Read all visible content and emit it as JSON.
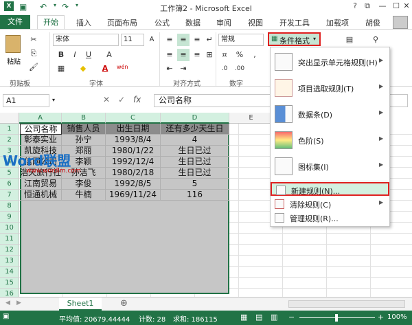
{
  "titlebar": {
    "title": "工作簿2 - Microsoft Excel",
    "help": "?",
    "restore": "⧉",
    "minimize": "—",
    "maximize": "☐",
    "close": "✕"
  },
  "tabs": {
    "file": "文件",
    "home": "开始",
    "insert": "插入",
    "page_layout": "页面布局",
    "formulas": "公式",
    "data": "数据",
    "review": "审阅",
    "view": "视图",
    "developer": "开发工具",
    "addins": "加载项",
    "user": "胡俊"
  },
  "ribbon": {
    "paste": "粘贴",
    "clipboard": "剪贴板",
    "font_name": "宋体",
    "font_size": "11",
    "font_group": "字体",
    "align_group": "对齐方式",
    "number_format": "常规",
    "number_group": "数字",
    "conditional_format": "条件格式",
    "bold": "B",
    "italic": "I",
    "underline": "U",
    "font_color": "A",
    "wen": "wén"
  },
  "formula_bar": {
    "name_box": "A1",
    "fx": "fx",
    "value": "公司名称"
  },
  "grid": {
    "columns": [
      "A",
      "B",
      "C",
      "D",
      "E"
    ],
    "rows": [
      [
        "公司名称",
        "销售人员",
        "出生日期",
        "还有多少天生日"
      ],
      [
        "彰泰实业",
        "孙宁",
        "1993/8/4",
        "4"
      ],
      [
        "凯旋科技",
        "郑丽",
        "1980/1/22",
        "生日已过"
      ],
      [
        "信网公司",
        "李颖",
        "1992/12/4",
        "生日已过"
      ],
      [
        "浩天旅行社",
        "孙洁飞",
        "1980/2/18",
        "生日已过"
      ],
      [
        "江南贸易",
        "李俊",
        "1992/8/5",
        "5"
      ],
      [
        "恒通机械",
        "牛楠",
        "1969/11/24",
        "116"
      ]
    ],
    "row_numbers": [
      "1",
      "2",
      "3",
      "4",
      "5",
      "6",
      "7",
      "8",
      "9",
      "10",
      "11",
      "12",
      "13",
      "14",
      "15",
      "16"
    ]
  },
  "watermark": {
    "brand": "Word联盟",
    "url": "www.wordlm.com"
  },
  "menu": {
    "items": [
      {
        "label": "突出显示单元格规则(H)"
      },
      {
        "label": "项目选取规则(T)"
      },
      {
        "label": "数据条(D)"
      },
      {
        "label": "色阶(S)"
      },
      {
        "label": "图标集(I)"
      }
    ],
    "small_items": [
      {
        "label": "新建规则(N)..."
      },
      {
        "label": "清除规则(C)"
      },
      {
        "label": "管理规则(R)..."
      }
    ]
  },
  "sheets": {
    "tab": "Sheet1",
    "add": "⊕"
  },
  "status": {
    "average": "平均值: 20679.44444",
    "count": "计数: 28",
    "sum": "求和: 186115",
    "zoom": "100%",
    "plus": "+",
    "minus": "−"
  },
  "colors": {
    "accent": "#217346",
    "highlight": "#e02020"
  }
}
